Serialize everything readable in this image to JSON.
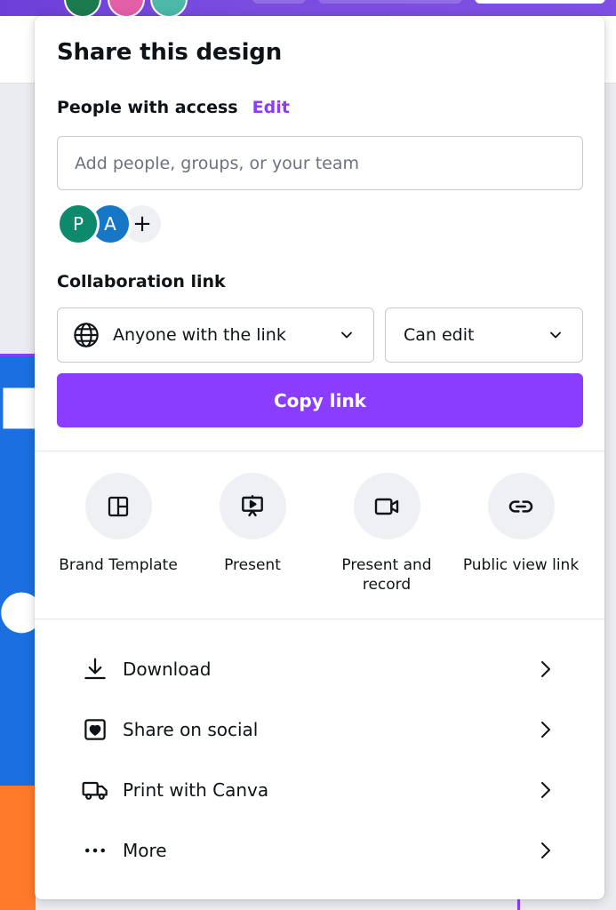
{
  "colors": {
    "accent": "#8b3dff",
    "avatar_p": "#0c8a6b",
    "avatar_a": "#1677c7"
  },
  "share": {
    "title": "Share this design",
    "people_label": "People with access",
    "edit_label": "Edit",
    "add_people_placeholder": "Add people, groups, or your team",
    "avatars": [
      {
        "initial": "P"
      },
      {
        "initial": "A"
      }
    ],
    "add_member_glyph": "+",
    "collab_label": "Collaboration link",
    "link_access": {
      "icon": "globe-icon",
      "value": "Anyone with the link"
    },
    "permission": {
      "value": "Can edit"
    },
    "copy_button": "Copy link"
  },
  "actions": [
    {
      "icon": "brand-template-icon",
      "label": "Brand Template"
    },
    {
      "icon": "present-icon",
      "label": "Present"
    },
    {
      "icon": "present-record-icon",
      "label": "Present and record"
    },
    {
      "icon": "link-icon",
      "label": "Public view link"
    }
  ],
  "menu": [
    {
      "icon": "download-icon",
      "label": "Download"
    },
    {
      "icon": "share-social-icon",
      "label": "Share on social"
    },
    {
      "icon": "print-truck-icon",
      "label": "Print with Canva"
    },
    {
      "icon": "more-dots-icon",
      "label": "More"
    }
  ]
}
